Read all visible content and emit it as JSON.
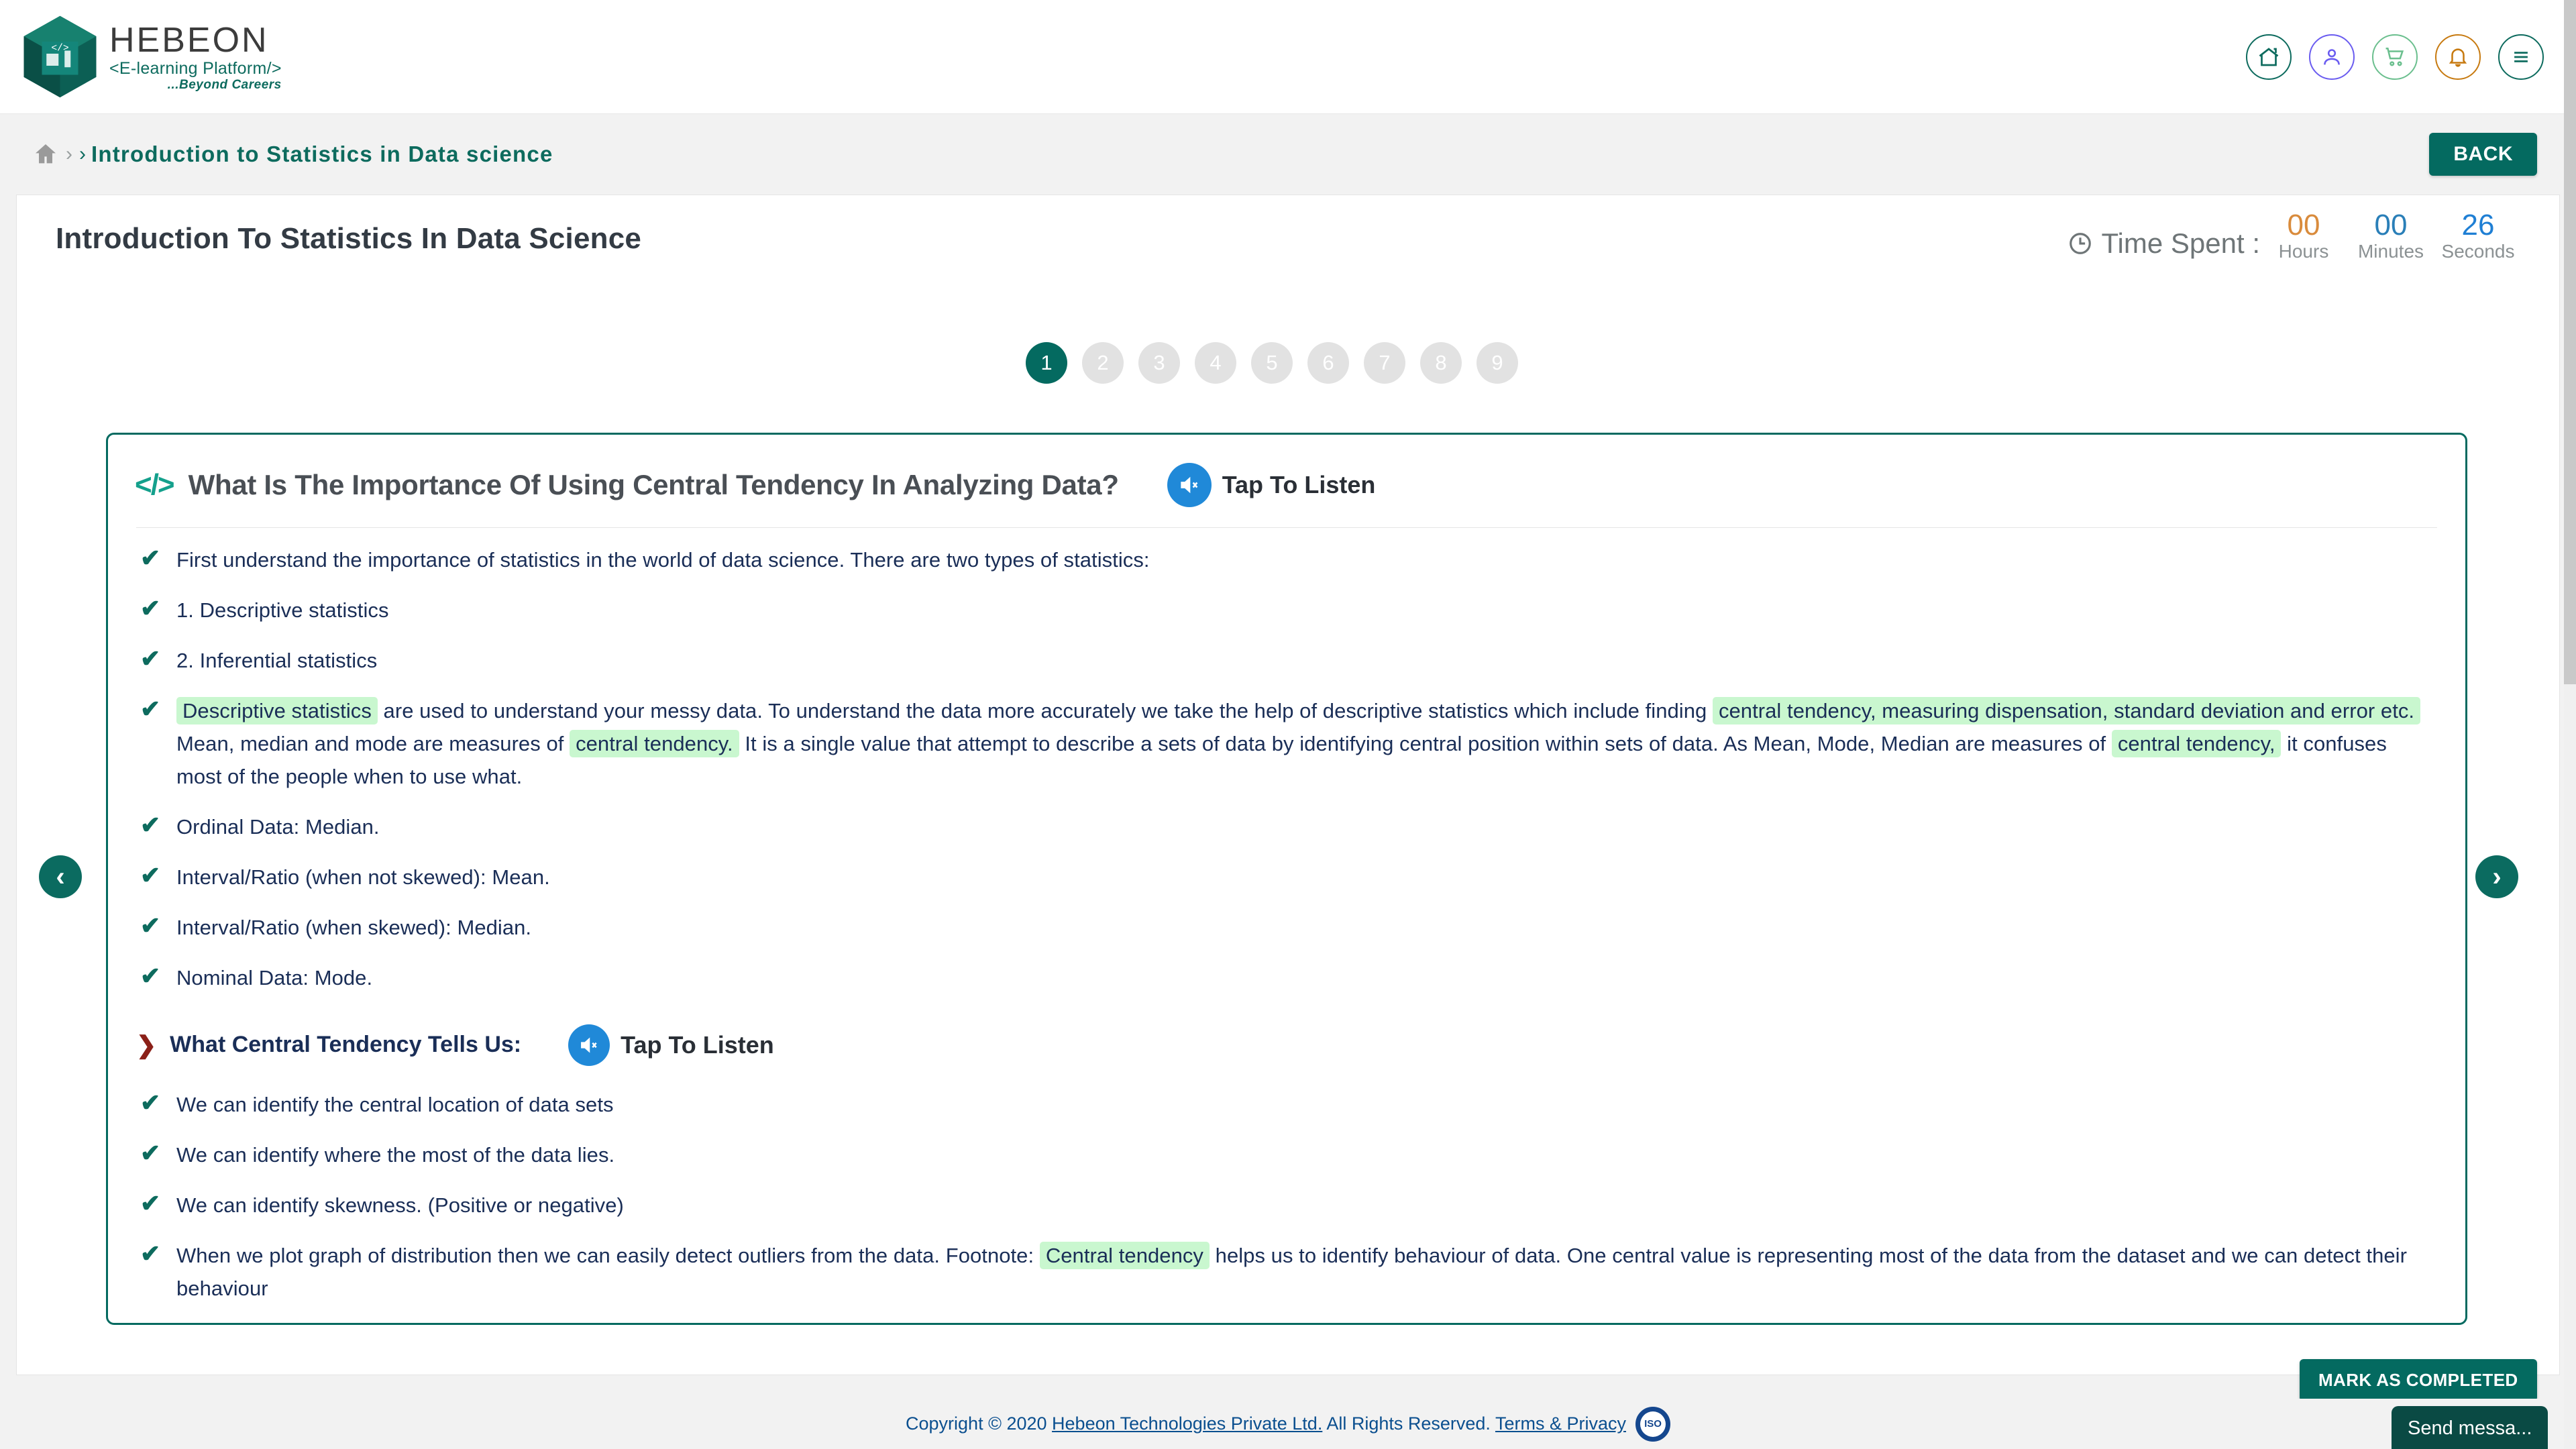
{
  "brand": {
    "name": "HEBEON",
    "subtitle": "<E-learning Platform/>",
    "tagline": "...Beyond Careers"
  },
  "topnav": {
    "items": [
      {
        "name": "home-icon",
        "color": "#0d6b5e"
      },
      {
        "name": "user-icon",
        "color": "#6a5cf0"
      },
      {
        "name": "cart-icon",
        "color": "#6bbf8e"
      },
      {
        "name": "bell-icon",
        "color": "#c77a10"
      },
      {
        "name": "menu-icon",
        "color": "#0d6b5e"
      }
    ]
  },
  "breadcrumb": {
    "home_icon": "home-icon",
    "separator": "›",
    "current": "Introduction to Statistics in Data science"
  },
  "back_button": "BACK",
  "page_title": "Introduction To Statistics In Data Science",
  "time_spent": {
    "label": "Time Spent :",
    "clock_icon": "clock-icon",
    "hours_value": "00",
    "hours_label": "Hours",
    "minutes_value": "00",
    "minutes_label": "Minutes",
    "seconds_value": "26",
    "seconds_label": "Seconds"
  },
  "pager": {
    "pages": [
      "1",
      "2",
      "3",
      "4",
      "5",
      "6",
      "7",
      "8",
      "9"
    ],
    "active_index": 0,
    "active_color": "#046a60",
    "inactive_color": "#e2e2e2"
  },
  "card": {
    "code_icon": "</>",
    "title": "What Is The Importance Of Using Central Tendency In Analyzing Data?",
    "listen_label": "Tap To Listen",
    "speaker_icon": "speaker-mute-icon",
    "bullets": [
      {
        "text": "First understand the importance of statistics in the world of data science. There are two types of statistics:"
      },
      {
        "text": "1. Descriptive statistics"
      },
      {
        "text": "2. Inferential statistics"
      },
      {
        "segments": [
          {
            "t": "Descriptive statistics",
            "hl": true
          },
          {
            "t": " are used to understand your messy data. To understand the data more accurately we take the help of descriptive statistics which include finding ",
            "hl": false
          },
          {
            "t": "central tendency, measuring dispensation, standard deviation and error etc.",
            "hl": true
          },
          {
            "t": " Mean, median and mode are measures of ",
            "hl": false
          },
          {
            "t": "central tendency.",
            "hl": true
          },
          {
            "t": " It is a single value that attempt to describe a sets of data by identifying central position within sets of data. As Mean, Mode, Median are measures of ",
            "hl": false
          },
          {
            "t": "central tendency,",
            "hl": true
          },
          {
            "t": " it confuses most of the people when to use what.",
            "hl": false
          }
        ]
      },
      {
        "text": "Ordinal Data: Median."
      },
      {
        "text": "Interval/Ratio (when not skewed): Mean."
      },
      {
        "text": "Interval/Ratio (when skewed): Median."
      },
      {
        "text": "Nominal Data: Mode."
      }
    ],
    "subsection": {
      "chevron": "❯",
      "title": "What Central Tendency Tells Us:",
      "listen_label": "Tap To Listen",
      "speaker_icon": "speaker-mute-icon",
      "bullets": [
        {
          "text": "We can identify the central location of data sets"
        },
        {
          "text": "We can identify where the most of the data lies."
        },
        {
          "text": "We can identify skewness. (Positive or negative)"
        },
        {
          "segments": [
            {
              "t": "When we plot graph of distribution then we can easily detect outliers from the data. Footnote: ",
              "hl": false
            },
            {
              "t": "Central tendency",
              "hl": true
            },
            {
              "t": " helps us to identify behaviour of data. One central value is representing most of the data from the dataset and we can detect their behaviour",
              "hl": false
            }
          ]
        }
      ]
    }
  },
  "nav_arrows": {
    "prev": "‹",
    "next": "›"
  },
  "mark_completed_button": "MARK AS COMPLETED",
  "footer": {
    "copyright_prefix": "Copyright © 2020 ",
    "company_link": "Hebeon Technologies Private Ltd.",
    "rights": " All Rights Reserved. ",
    "terms_link": "Terms & Privacy",
    "iso_badge": "ISO"
  },
  "chat_widget": {
    "label": "Send messa..."
  },
  "colors": {
    "brand_teal": "#046a60",
    "highlight_green": "#c9f7cf",
    "body_navy": "#1a2e57"
  }
}
